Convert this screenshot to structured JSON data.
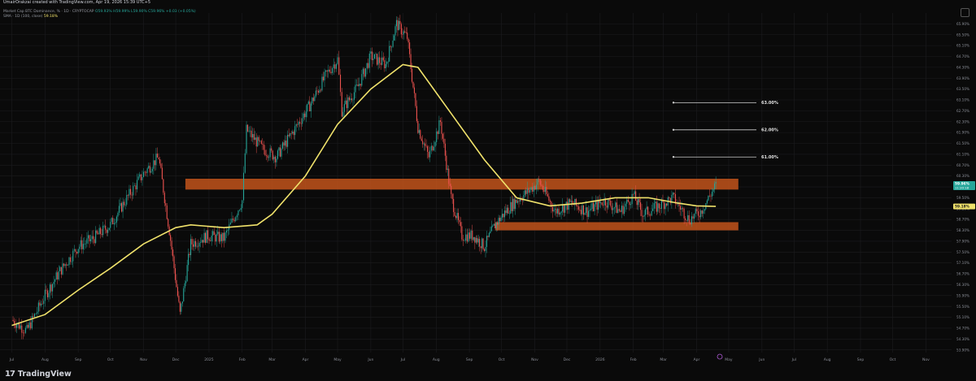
{
  "header": {
    "credit": "UmairOrakzai created with TradingView.com, Apr 19, 2026 15:39 UTC+5"
  },
  "series": {
    "title": "Market Cap BTC Dominance, % · 1D · CRYPTOCAP",
    "ohlc": "O59.93% H59.99% L59.90% C59.96% +0.03 (+0.05%)",
    "sma_label": "SMA · 1D (100, close)",
    "sma_value": "59.18%"
  },
  "footer": {
    "brand": "TradingView"
  },
  "colors": {
    "up": "#26a69a",
    "down": "#ef5350",
    "sma": "#f0e26b",
    "zone": "#c2531b",
    "grid": "#1c1c1f",
    "bg": "#0a0a0a"
  },
  "chart_data": {
    "type": "candlestick",
    "title": "Market Cap BTC Dominance, % · 1D · CRYPTOCAP",
    "x_axis": [
      "Jul",
      "Aug",
      "Sep",
      "Oct",
      "Nov",
      "Dec",
      "2025",
      "Feb",
      "Mar",
      "Apr",
      "May",
      "Jun",
      "Jul",
      "Aug",
      "Sep",
      "Oct",
      "Nov",
      "Dec",
      "2026",
      "Feb",
      "Mar",
      "Apr",
      "May",
      "Jun",
      "Jul",
      "Aug",
      "Sep",
      "Oct",
      "Nov"
    ],
    "y_ticks": [
      "65.90%",
      "65.50%",
      "65.10%",
      "64.70%",
      "64.30%",
      "63.90%",
      "63.50%",
      "63.10%",
      "62.70%",
      "62.30%",
      "61.90%",
      "61.50%",
      "61.10%",
      "60.70%",
      "60.30%",
      "59.90%",
      "59.50%",
      "59.10%",
      "58.70%",
      "58.30%",
      "57.90%",
      "57.50%",
      "57.10%",
      "56.70%",
      "56.30%",
      "55.90%",
      "55.50%",
      "55.10%",
      "54.70%",
      "54.30%",
      "53.90%"
    ],
    "ylim": [
      53.8,
      66.3
    ],
    "last_price": "59.96%",
    "countdown": "11:20:18",
    "sma_last": "59.18%",
    "price_path": [
      [
        "2024-07-01",
        55.0
      ],
      [
        "2024-07-15",
        54.6
      ],
      [
        "2024-08-01",
        55.9
      ],
      [
        "2024-08-15",
        56.8
      ],
      [
        "2024-09-01",
        57.7
      ],
      [
        "2024-09-15",
        58.0
      ],
      [
        "2024-10-01",
        58.5
      ],
      [
        "2024-10-15",
        59.4
      ],
      [
        "2024-11-01",
        60.4
      ],
      [
        "2024-11-15",
        61.0
      ],
      [
        "2024-11-25",
        58.3
      ],
      [
        "2024-12-05",
        55.2
      ],
      [
        "2024-12-15",
        57.8
      ],
      [
        "2024-12-31",
        58.1
      ],
      [
        "2025-01-15",
        58.0
      ],
      [
        "2025-02-01",
        59.4
      ],
      [
        "2025-02-05",
        62.0
      ],
      [
        "2025-02-20",
        61.3
      ],
      [
        "2025-03-05",
        61.0
      ],
      [
        "2025-03-20",
        61.9
      ],
      [
        "2025-04-05",
        62.9
      ],
      [
        "2025-04-20",
        64.0
      ],
      [
        "2025-05-01",
        64.6
      ],
      [
        "2025-05-05",
        62.7
      ],
      [
        "2025-05-20",
        63.6
      ],
      [
        "2025-06-01",
        64.7
      ],
      [
        "2025-06-15",
        64.4
      ],
      [
        "2025-06-25",
        65.9
      ],
      [
        "2025-07-05",
        65.4
      ],
      [
        "2025-07-15",
        62.1
      ],
      [
        "2025-07-25",
        61.0
      ],
      [
        "2025-08-05",
        62.3
      ],
      [
        "2025-08-15",
        59.5
      ],
      [
        "2025-08-25",
        58.1
      ],
      [
        "2025-09-05",
        58.1
      ],
      [
        "2025-09-15",
        57.7
      ],
      [
        "2025-09-25",
        58.5
      ],
      [
        "2025-10-05",
        59.0
      ],
      [
        "2025-10-15",
        59.4
      ],
      [
        "2025-10-25",
        59.7
      ],
      [
        "2025-11-05",
        60.1
      ],
      [
        "2025-11-20",
        59.0
      ],
      [
        "2025-12-05",
        59.3
      ],
      [
        "2025-12-20",
        59.0
      ],
      [
        "2026-01-05",
        59.4
      ],
      [
        "2026-01-20",
        59.0
      ],
      [
        "2026-02-01",
        59.6
      ],
      [
        "2026-02-10",
        58.9
      ],
      [
        "2026-02-25",
        59.2
      ],
      [
        "2026-03-10",
        59.5
      ],
      [
        "2026-03-25",
        58.7
      ],
      [
        "2026-04-05",
        59.0
      ],
      [
        "2026-04-19",
        59.96
      ]
    ],
    "sma_path": [
      [
        "2024-07-01",
        54.8
      ],
      [
        "2024-08-01",
        55.2
      ],
      [
        "2024-09-01",
        56.1
      ],
      [
        "2024-10-01",
        56.9
      ],
      [
        "2024-11-01",
        57.8
      ],
      [
        "2024-12-01",
        58.4
      ],
      [
        "2024-12-15",
        58.5
      ],
      [
        "2025-01-15",
        58.4
      ],
      [
        "2025-02-15",
        58.5
      ],
      [
        "2025-03-01",
        58.9
      ],
      [
        "2025-04-01",
        60.3
      ],
      [
        "2025-05-01",
        62.2
      ],
      [
        "2025-06-01",
        63.5
      ],
      [
        "2025-07-01",
        64.4
      ],
      [
        "2025-07-15",
        64.3
      ],
      [
        "2025-08-15",
        62.6
      ],
      [
        "2025-09-15",
        60.9
      ],
      [
        "2025-10-15",
        59.5
      ],
      [
        "2025-11-15",
        59.2
      ],
      [
        "2025-12-15",
        59.3
      ],
      [
        "2026-01-15",
        59.5
      ],
      [
        "2026-02-15",
        59.5
      ],
      [
        "2026-03-15",
        59.3
      ],
      [
        "2026-04-01",
        59.2
      ],
      [
        "2026-04-19",
        59.18
      ]
    ],
    "zones": [
      {
        "from": "2024-12-10",
        "to": "2026-05-10",
        "low": 59.8,
        "high": 60.2
      },
      {
        "from": "2025-09-25",
        "to": "2026-05-10",
        "low": 58.3,
        "high": 58.6
      }
    ],
    "targets": [
      {
        "label": "63.00%",
        "value": 63.0
      },
      {
        "label": "62.00%",
        "value": 62.0
      },
      {
        "label": "61.00%",
        "value": 61.0
      }
    ],
    "grid": true
  }
}
